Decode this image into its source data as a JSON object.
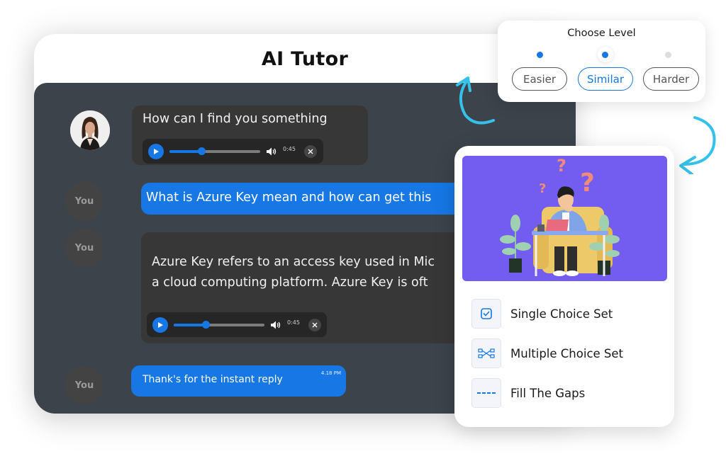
{
  "tutor": {
    "title": "AI Tutor"
  },
  "chat": {
    "messages": [
      {
        "sender": "bot",
        "avatar": "tutor-photo",
        "text": "How can I find you something",
        "audio": {
          "time": "0:45",
          "progress": 0.35
        }
      },
      {
        "sender": "user",
        "avatar_label": "You",
        "text": "What is Azure Key mean and how can get this"
      },
      {
        "sender": "bot",
        "avatar_label": "You",
        "text_lines": [
          "Azure Key refers to an access key used in Mic",
          "a cloud computing platform. Azure Key is oft"
        ],
        "audio": {
          "time": "0:45",
          "progress": 0.35
        }
      },
      {
        "sender": "user",
        "avatar_label": "You",
        "text": "Thank's for the instant reply",
        "timestamp": "4.18 PM"
      }
    ]
  },
  "level_picker": {
    "title": "Choose Level",
    "options": [
      {
        "label": "Easier",
        "dot": "filled"
      },
      {
        "label": "Similar",
        "dot": "filled-selected",
        "selected": true
      },
      {
        "label": "Harder",
        "dot": "empty"
      }
    ]
  },
  "quiz_types": {
    "illustration": "thinking-person-at-desk-illustration",
    "items": [
      {
        "label": "Single Choice Set",
        "icon": "checkbox-icon"
      },
      {
        "label": "Multiple Choice Set",
        "icon": "connected-nodes-icon"
      },
      {
        "label": "Fill The Gaps",
        "icon": "dashed-line-icon"
      }
    ]
  },
  "colors": {
    "accent": "#1677e5",
    "chat_bg": "#3d434b",
    "bot_bubble": "#373737",
    "illustration_bg": "#735cf0",
    "arrow": "#35c1ea"
  }
}
